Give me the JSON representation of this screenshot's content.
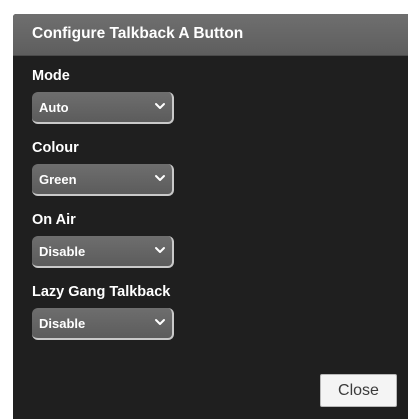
{
  "dialog": {
    "title": "Configure Talkback A Button",
    "fields": [
      {
        "label": "Mode",
        "value": "Auto"
      },
      {
        "label": "Colour",
        "value": "Green"
      },
      {
        "label": "On Air",
        "value": "Disable"
      },
      {
        "label": "Lazy Gang Talkback",
        "value": "Disable"
      }
    ],
    "close_label": "Close"
  },
  "icons": {
    "select_chevron": "chevron-down-icon"
  },
  "colors": {
    "dialog_background": "#1f1f1f",
    "header_background": "#666666",
    "select_background": "#666666",
    "text": "#ffffff"
  }
}
